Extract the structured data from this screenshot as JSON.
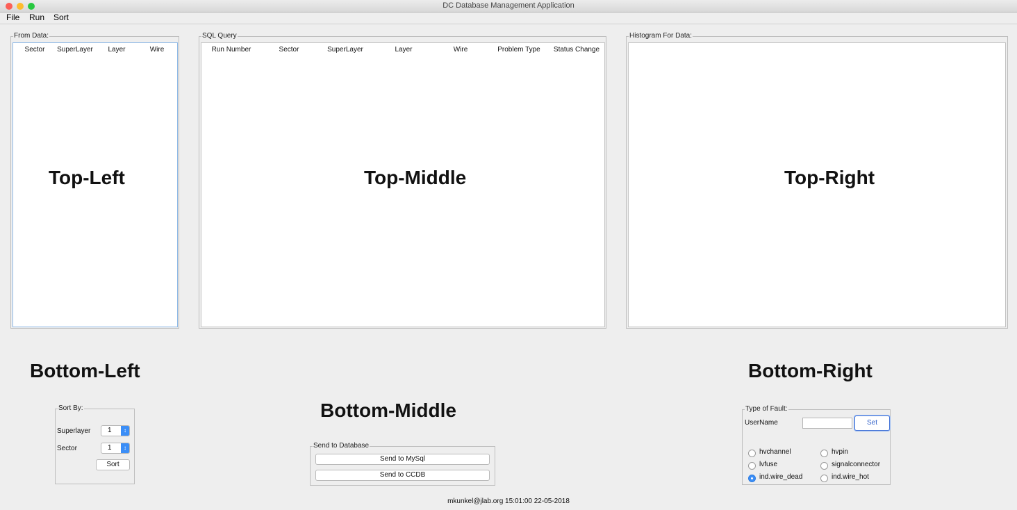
{
  "window": {
    "title": "DC Database Management Application"
  },
  "menu": [
    "File",
    "Run",
    "Sort"
  ],
  "from_data": {
    "legend": "From Data:",
    "columns": [
      "Sector",
      "SuperLayer",
      "Layer",
      "Wire"
    ]
  },
  "sql_query": {
    "legend": "SQL Query",
    "columns": [
      "Run Number",
      "Sector",
      "SuperLayer",
      "Layer",
      "Wire",
      "Problem Type",
      "Status Change"
    ]
  },
  "histogram": {
    "legend": "Histogram For Data:"
  },
  "overlays": {
    "top_left": "Top-Left",
    "top_middle": "Top-Middle",
    "top_right": "Top-Right",
    "bottom_left": "Bottom-Left",
    "bottom_middle": "Bottom-Middle",
    "bottom_right": "Bottom-Right"
  },
  "sort_by": {
    "legend": "Sort By:",
    "superlayer_label": "Superlayer",
    "superlayer_value": "1",
    "sector_label": "Sector",
    "sector_value": "1",
    "sort_button": "Sort"
  },
  "send_to_db": {
    "legend": "Send to Database",
    "mysql_button": "Send to MySql",
    "ccdb_button": "Send to CCDB"
  },
  "fault": {
    "legend": "Type of Fault:",
    "username_label": "UserName",
    "username_value": "",
    "set_button": "Set",
    "options": [
      "hvchannel",
      "hvpin",
      "lvfuse",
      "signalconnector",
      "ind.wire_dead",
      "ind.wire_hot"
    ],
    "selected": "ind.wire_dead"
  },
  "status": {
    "text": "mkunkel@jlab.org 15:01:00  22-05-2018"
  }
}
